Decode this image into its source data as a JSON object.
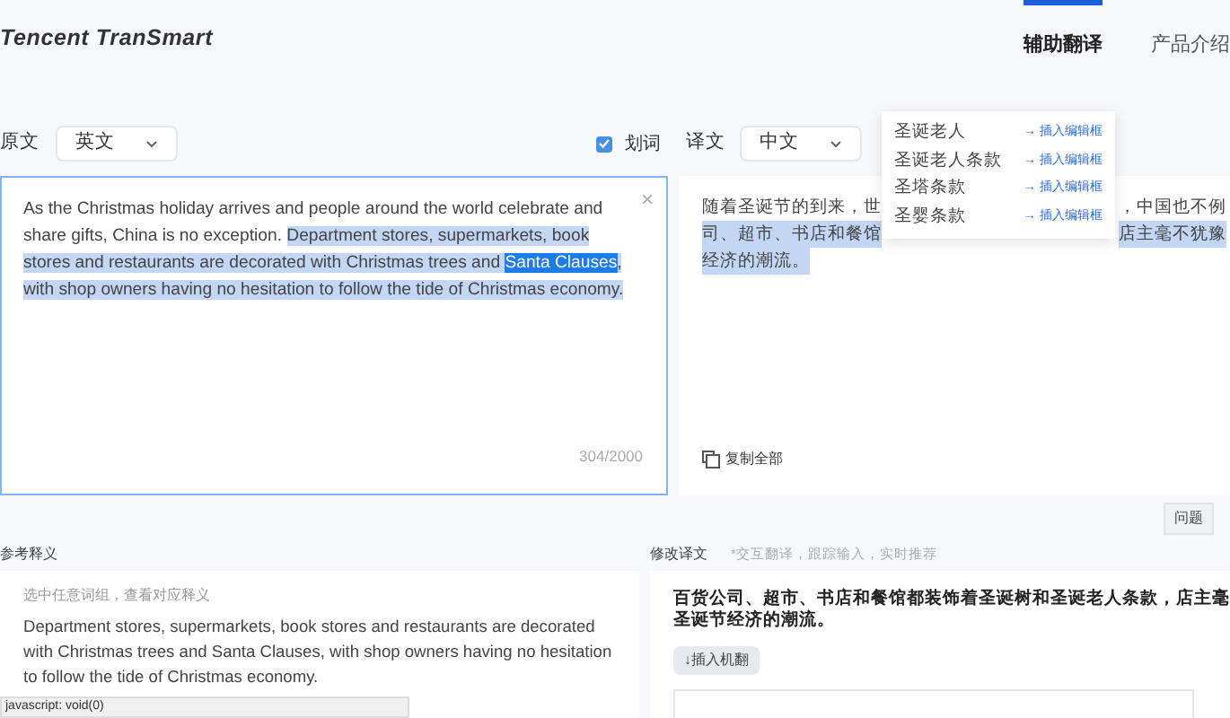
{
  "header": {
    "logo": "Tencent TranSmart",
    "nav": [
      {
        "label": "辅助翻译",
        "selected": true
      },
      {
        "label": "产品介绍",
        "selected": false
      }
    ]
  },
  "source": {
    "label": "原文",
    "language": "英文",
    "segments": [
      {
        "kind": "plain",
        "text": "As the Christmas holiday arrives and people around the world celebrate and share gifts, China is no exception. "
      },
      {
        "kind": "selected",
        "text": "Department stores, supermarkets, book stores and restaurants are decorated with Christmas trees and "
      },
      {
        "kind": "active",
        "text": "Santa Clauses"
      },
      {
        "kind": "selected",
        "text": ", with shop owners having no hesitation to follow the tide of Christmas economy."
      }
    ],
    "counter": "304/2000",
    "close": "×"
  },
  "word_select": {
    "label": "划词",
    "checked": true
  },
  "target": {
    "label": "译文",
    "language": "中文",
    "lines": [
      {
        "left": "随着圣诞节的到来，世",
        "right": "，中国也不例",
        "selected": false
      },
      {
        "left": "司、超市、书店和餐馆",
        "right": "店主毫不犹豫",
        "selected": true
      },
      {
        "left": "经济的潮流。",
        "selected": true
      }
    ],
    "copy_all": "复制全部"
  },
  "suggestions": [
    {
      "term": "圣诞老人",
      "action": "→ 插入编辑框"
    },
    {
      "term": "圣诞老人条款",
      "action": "→ 插入编辑框"
    },
    {
      "term": "圣塔条款",
      "action": "→ 插入编辑框"
    },
    {
      "term": "圣婴条款",
      "action": "→ 插入编辑框"
    }
  ],
  "reference": {
    "label": "参考释义",
    "hint": "选中任意词组，查看对应释义",
    "text": "Department stores, supermarkets, book stores and restaurants are decorated with Christmas trees and Santa Clauses, with shop owners having no hesitation to follow the tide of Christmas economy."
  },
  "edit": {
    "issues_button": "问题",
    "label": "修改译文",
    "hint": "*交互翻译，跟踪输入，实时推荐",
    "text": "百货公司、超市、书店和餐馆都装饰着圣诞树和圣诞老人条款，店主毫",
    "text_line2": "圣诞节经济的潮流。",
    "insert_button": "↓插入机翻"
  },
  "status_bar": "javascript: void(0)"
}
